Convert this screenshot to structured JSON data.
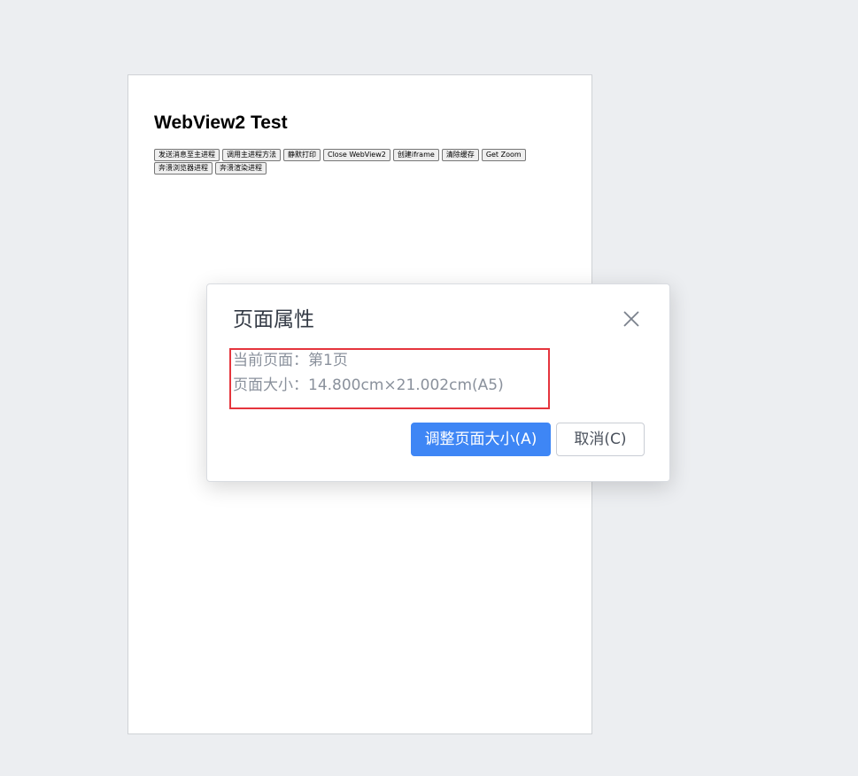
{
  "document": {
    "title": "WebView2 Test",
    "buttons": [
      "发送消息至主进程",
      "调用主进程方法",
      "静默打印",
      "Close WebView2",
      "创建iframe",
      "清除缓存",
      "Get Zoom",
      "奔溃浏览器进程",
      "奔溃渲染进程"
    ]
  },
  "dialog": {
    "title": "页面属性",
    "current_page": "当前页面：第1页",
    "page_size": "页面大小：14.800cm×21.002cm(A5)",
    "confirm_label": "调整页面大小(A)",
    "cancel_label": "取消(C)",
    "close_icon": "close-icon"
  },
  "colors": {
    "primary": "#3e86f5",
    "highlight_border": "#e5353d",
    "background": "#eceef1"
  }
}
